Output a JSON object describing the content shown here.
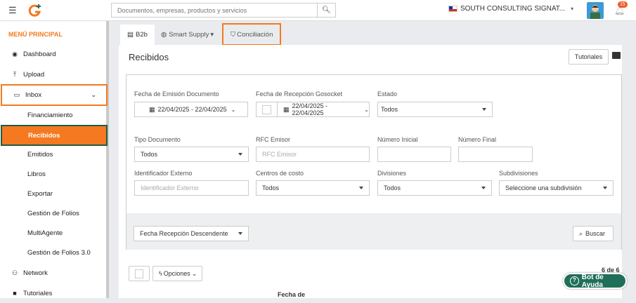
{
  "topbar": {
    "search_placeholder": "Documentos, empresas, productos y servicios",
    "company": "SOUTH CONSULTING SIGNAT...",
    "notif_count": "15"
  },
  "sidebar": {
    "title": "MENÚ PRINCIPAL",
    "items": {
      "dashboard": "Dashboard",
      "upload": "Upload",
      "inbox": "Inbox",
      "network": "Network",
      "tutoriales": "Tutoriales"
    },
    "subitems": [
      "Financiamiento",
      "Recibidos",
      "Emitidos",
      "Libros",
      "Exportar",
      "Gestión de Folios",
      "MultiAgente",
      "Gestión de Folios 3.0"
    ]
  },
  "tabs": {
    "b2b": "B2b",
    "smart": "Smart Supply",
    "concil": "Conciliación"
  },
  "page": {
    "title": "Recibidos",
    "tutoriales_btn": "Tutoriales"
  },
  "filters": {
    "fecha_emision_label": "Fecha de Emisión Documento",
    "fecha_emision_value": "22/04/2025 - 22/04/2025",
    "fecha_recepcion_label": "Fecha de Recepción Gosocket",
    "fecha_recepcion_value": "22/04/2025 - 22/04/2025",
    "estado_label": "Estado",
    "estado_value": "Todos",
    "tipo_label": "Tipo Documento",
    "tipo_value": "Todos",
    "rfc_label": "RFC Emisor",
    "rfc_placeholder": "RFC Emisor",
    "num_ini_label": "Número Inicial",
    "num_fin_label": "Número Final",
    "ident_label": "Identificador Externo",
    "ident_placeholder": "Identificador Externo",
    "centros_label": "Centros de costo",
    "centros_value": "Todos",
    "div_label": "Divisiones",
    "div_value": "Todos",
    "subdiv_label": "Subdivisiones",
    "subdiv_value": "Seleccione una subdivisión",
    "order_value": "Fecha Recepción Descendente",
    "buscar": "Buscar"
  },
  "list": {
    "opciones": "Opciones",
    "pager": "6 de 6",
    "col_fecha": "Fecha de"
  },
  "bot": "Bot de Ayuda"
}
